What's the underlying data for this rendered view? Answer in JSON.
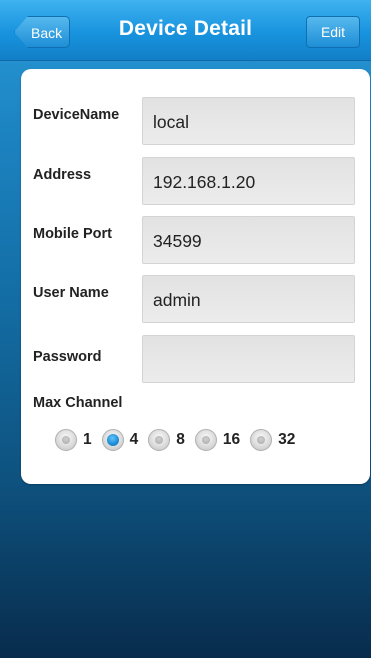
{
  "header": {
    "title": "Device Detail",
    "back_label": "Back",
    "edit_label": "Edit"
  },
  "form": {
    "device_name": {
      "label": "DeviceName",
      "value": "local"
    },
    "address": {
      "label": "Address",
      "value": "192.168.1.20"
    },
    "mobile_port": {
      "label": "Mobile Port",
      "value": "34599"
    },
    "user_name": {
      "label": "User Name",
      "value": "admin"
    },
    "password": {
      "label": "Password",
      "value": ""
    },
    "max_channel": {
      "label": "Max Channel",
      "options": [
        "1",
        "4",
        "8",
        "16",
        "32"
      ],
      "selected": "4"
    }
  },
  "colors": {
    "header_blue": "#1893de",
    "background_blue": "#136da4",
    "radio_selected": "#1b8dd6"
  }
}
